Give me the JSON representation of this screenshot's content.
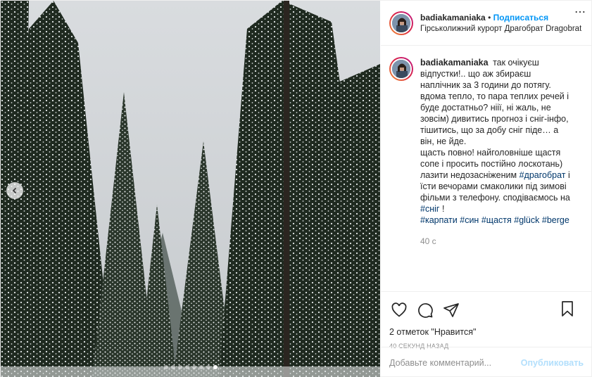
{
  "post": {
    "username": "badiakamaniaka",
    "separator": "•",
    "follow_label": "Подписаться",
    "location": "Гірськолижний курорт Драгобрат Dragobrat",
    "more_icon": "more-horizontal-icon"
  },
  "caption": {
    "username": "badiakamaniaka",
    "text_1": "так очікуєш відпустки!.. що аж збираєш наплічник за 3 години до потягу. вдома тепло, то пара теплих речей і буде достатньо? ніії, ні жаль, не зовсім) дивитись прогноз і сніг-інфо, тішитись, що за добу сніг піде… а він, не йде.",
    "text_2": "щасть повно! найголовніше щастя сопе і просить постійно лоскотань) лазити недозасніженим",
    "tag_1": "#драгобрат",
    "text_3": "і їсти вечорами смаколики під зимові фільми з телефону.",
    "text_4": "сподіваємось на",
    "tag_2": "#сніг",
    "text_5": "!",
    "tags": [
      "#карпати",
      "#син",
      "#щастя",
      "#glück",
      "#berge"
    ],
    "time": "40 с"
  },
  "actions": {
    "like_icon": "heart-icon",
    "comment_icon": "comment-icon",
    "share_icon": "share-icon",
    "save_icon": "bookmark-icon",
    "likes_text": "2 отметок \"Нравится\"",
    "timestamp": "40 СЕКУНД НАЗАД"
  },
  "comment_box": {
    "placeholder": "Добавьте комментарий...",
    "publish_label": "Опубликовать"
  },
  "carousel": {
    "total": 8,
    "active_index": 7
  },
  "colors": {
    "link_blue": "#0095f6",
    "hashtag": "#00376b",
    "muted": "#8e8e8e",
    "publish_disabled": "#b2dffc"
  }
}
